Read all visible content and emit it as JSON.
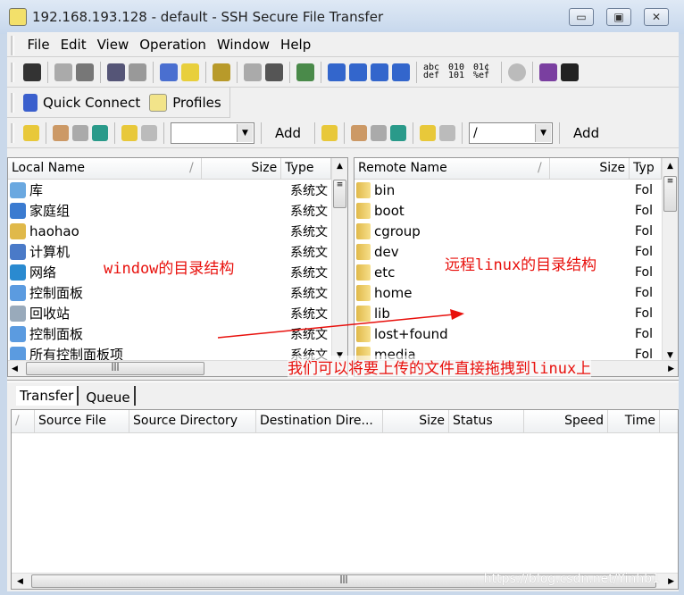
{
  "window": {
    "title": "192.168.193.128 - default - SSH Secure File Transfer",
    "minimize": "▭",
    "maximize": "▣",
    "close": "✕"
  },
  "menu": [
    "File",
    "Edit",
    "View",
    "Operation",
    "Window",
    "Help"
  ],
  "toolbar": {
    "icons": [
      "save-icon",
      "connect-icon",
      "disconnect-icon",
      "copy-icon",
      "paste-icon",
      "new-terminal-icon",
      "new-file-transfer-icon",
      "settings-icon",
      "download-icon",
      "upload-icon",
      "window-icon",
      "large-icons-icon",
      "small-icons-icon",
      "list-icon",
      "details-icon",
      "ascii-icon",
      "binary-icon",
      "auto-mode-icon",
      "stop-icon",
      "help-icon",
      "whats-this-icon"
    ],
    "ascii": "abc def",
    "binary": "010 101",
    "auto": "01¢ %ef"
  },
  "quick": {
    "connect": "Quick Connect",
    "profiles": "Profiles"
  },
  "local": {
    "path": "",
    "add": "Add",
    "headers": {
      "name": "Local Name",
      "size": "Size",
      "type": "Type"
    },
    "items": [
      {
        "name": "库",
        "type": "系统文"
      },
      {
        "name": "家庭组",
        "type": "系统文"
      },
      {
        "name": "haohao",
        "type": "系统文"
      },
      {
        "name": "计算机",
        "type": "系统文"
      },
      {
        "name": "网络",
        "type": "系统文"
      },
      {
        "name": "控制面板",
        "type": "系统文"
      },
      {
        "name": "回收站",
        "type": "系统文"
      },
      {
        "name": "控制面板",
        "type": "系统文"
      },
      {
        "name": "所有控制面板项",
        "type": "系统文"
      }
    ]
  },
  "remote": {
    "path": "/",
    "add": "Add",
    "headers": {
      "name": "Remote Name",
      "size": "Size",
      "type": "Typ"
    },
    "items": [
      {
        "name": "bin",
        "type": "Fol"
      },
      {
        "name": "boot",
        "type": "Fol"
      },
      {
        "name": "cgroup",
        "type": "Fol"
      },
      {
        "name": "dev",
        "type": "Fol"
      },
      {
        "name": "etc",
        "type": "Fol"
      },
      {
        "name": "home",
        "type": "Fol"
      },
      {
        "name": "lib",
        "type": "Fol"
      },
      {
        "name": "lost+found",
        "type": "Fol"
      },
      {
        "name": "media",
        "type": "Fol"
      }
    ]
  },
  "annotations": {
    "local": "window的目录结构",
    "remote": "远程linux的目录结构",
    "drag": "我们可以将要上传的文件直接拖拽到linux上",
    "color": "#e8100c"
  },
  "transfer": {
    "tabs": [
      "Transfer",
      "Queue"
    ],
    "headers": [
      "Source File",
      "Source Directory",
      "Destination Dire...",
      "Size",
      "Status",
      "Speed",
      "Time"
    ]
  },
  "watermark": "https://blog.csdn.net/Yinhb1"
}
